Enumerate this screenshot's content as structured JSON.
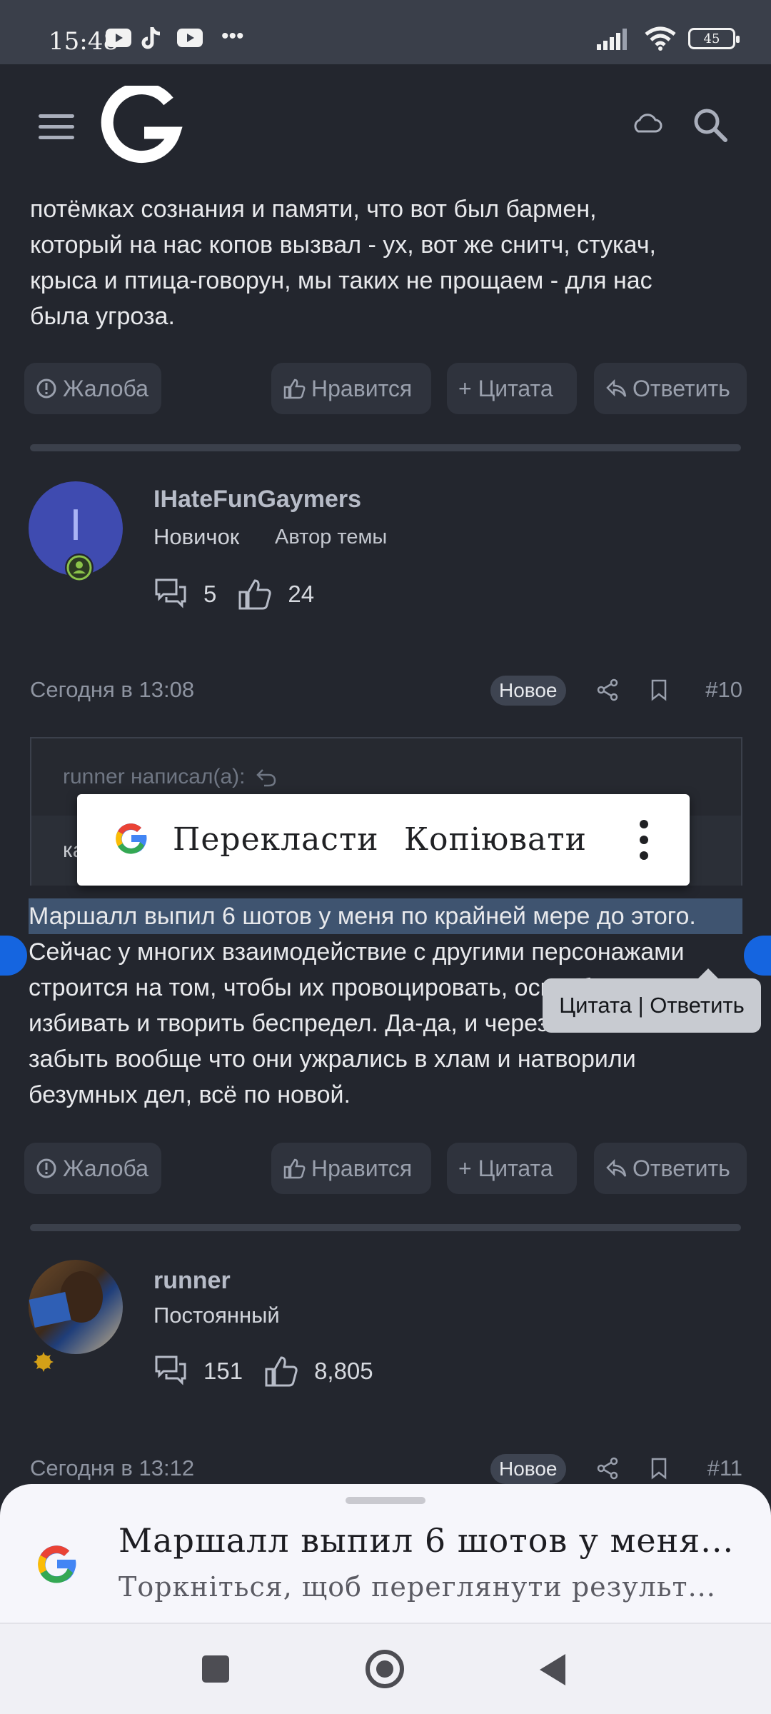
{
  "status_bar": {
    "time": "15:48",
    "battery": "45",
    "more": "•••"
  },
  "post_top": {
    "text_lines": [
      "потёмках сознания и памяти, что вот был бармен,",
      "который на нас копов вызвал - ух, вот же снитч, стукач,",
      "крыса и птица-говорун, мы таких не прощаем - для нас",
      "была угроза."
    ]
  },
  "actions": {
    "report": "Жалоба",
    "like": "Нравится",
    "quote": "+ Цитата",
    "reply": "Ответить"
  },
  "user1": {
    "initial": "I",
    "name": "IHateFunGaymers",
    "rank": "Новичок",
    "topic_author": "Автор темы",
    "messages": "5",
    "likes": "24"
  },
  "post10": {
    "date": "Сегодня в 13:08",
    "badge": "Новое",
    "number": "#10",
    "quote_author": "runner написал(а):",
    "quote_text": "ка",
    "text_lines": [
      "Маршалл выпил 6 шотов у меня по крайней мере до этого.",
      "Сейчас у многих взаимодействие с другими персонажами",
      "строится на том, чтобы их провоцировать, оскорблять,",
      "избивать и творить беспредел. Да-да, и через 1-2 часа",
      "забыть вообще что они ужрались в хлам и натворили",
      "безумных дел, всё по новой."
    ],
    "popover": "Цитата | Ответить"
  },
  "context_menu": {
    "translate": "Перекласти",
    "copy": "Копіювати"
  },
  "user2": {
    "name": "runner",
    "rank": "Постоянный",
    "messages": "151",
    "likes": "8,805"
  },
  "post11": {
    "date": "Сегодня в 13:12",
    "badge": "Новое",
    "number": "#11"
  },
  "bottom_sheet": {
    "title": "Маршалл выпил 6 шотов у меня...",
    "subtitle": "Торкніться, щоб переглянути результ..."
  },
  "colors": {
    "background": "#23262e",
    "status_bar": "#3a3f4a",
    "avatar1": "#3f4bb0",
    "online_badge": "#8bc34a",
    "selection": "#3f5470",
    "handle": "#1565e0"
  },
  "icons": [
    "menu-icon",
    "site-logo",
    "cloud-icon",
    "search-icon",
    "youtube-icon",
    "tiktok-icon",
    "signal-icon",
    "wifi-icon",
    "alert-icon",
    "thumbs-up-icon",
    "reply-icon",
    "share-icon",
    "bookmark-icon",
    "messages-icon",
    "google-icon"
  ]
}
